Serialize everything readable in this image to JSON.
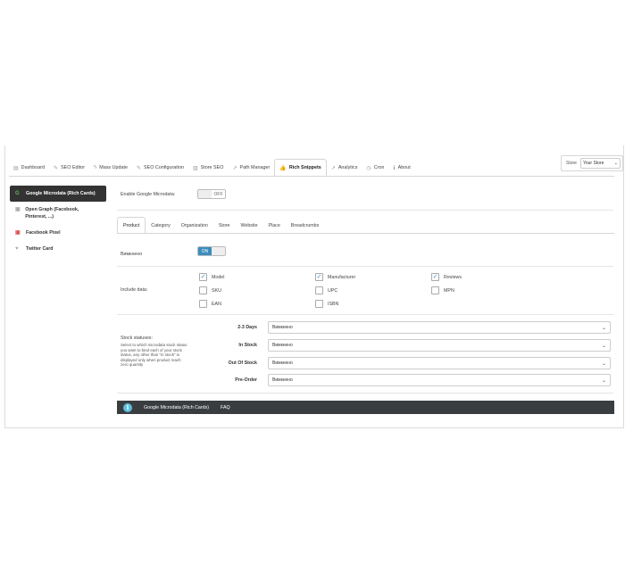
{
  "tabs": [
    {
      "label": "Dashboard",
      "icon": "dashboard-icon",
      "glyph": "▤"
    },
    {
      "label": "SEO Editor",
      "icon": "edit-icon",
      "glyph": "✎"
    },
    {
      "label": "Mass Update",
      "icon": "bolt-icon",
      "glyph": "ϟ"
    },
    {
      "label": "SEO Configuration",
      "icon": "wrench-icon",
      "glyph": "✎"
    },
    {
      "label": "Store SEO",
      "icon": "store-icon",
      "glyph": "▥"
    },
    {
      "label": "Path Manager",
      "icon": "path-icon",
      "glyph": "↗"
    },
    {
      "label": "Rich Snippets",
      "icon": "thumbs-up-icon",
      "glyph": "👍"
    },
    {
      "label": "Analytics",
      "icon": "chart-icon",
      "glyph": "↗"
    },
    {
      "label": "Cron",
      "icon": "clock-icon",
      "glyph": "◷"
    },
    {
      "label": "About",
      "icon": "info-icon",
      "glyph": "ℹ"
    }
  ],
  "store": {
    "label": "Store",
    "selected": "Your Store"
  },
  "sidebar": {
    "items": [
      {
        "label": "Google Microdata (Rich Cards)",
        "glyph": "G"
      },
      {
        "label": "Open Graph (Facebook, Pinterest, ...)",
        "glyph": "▣"
      },
      {
        "label": "Facebook Pixel",
        "glyph": "▣"
      },
      {
        "label": "Twitter Card",
        "glyph": "♥"
      }
    ]
  },
  "enable": {
    "label": "Enable Google Microdata:",
    "on_text": "",
    "off_text": "OFF"
  },
  "subtabs": [
    "Product",
    "Category",
    "Organization",
    "Store",
    "Website",
    "Place",
    "Breadcrumbs"
  ],
  "enabled_row": {
    "label": "Вимкнено",
    "on_text": "ON",
    "off_text": ""
  },
  "include": {
    "label": "Include data:",
    "items": [
      {
        "label": "Model",
        "checked": true
      },
      {
        "label": "Manufacturer",
        "checked": true
      },
      {
        "label": "Reviews",
        "checked": true
      },
      {
        "label": "SKU",
        "checked": false
      },
      {
        "label": "UPC",
        "checked": false
      },
      {
        "label": "MPN",
        "checked": false
      },
      {
        "label": "EAN",
        "checked": false
      },
      {
        "label": "ISBN",
        "checked": false
      }
    ]
  },
  "stock": {
    "title": "Stock statuses:",
    "description": "Select to which microdata stock status you want to bind each of your stock status, any other than \"in stock\" is displayed only when product reach zero quantity",
    "rows": [
      {
        "label": "2-3 Days",
        "value": "Вимкнено"
      },
      {
        "label": "In Stock",
        "value": "Вимкнено"
      },
      {
        "label": "Out Of Stock",
        "value": "Вимкнено"
      },
      {
        "label": "Pre-Order",
        "value": "Вимкнено"
      }
    ]
  },
  "footer": {
    "links": [
      "Google Microdata (Rich Cards)",
      "FAQ"
    ]
  },
  "colors": {
    "accent": "#3c8dbc",
    "active_icon": "#5cb85c",
    "footer_bg": "#3a3d40",
    "info": "#5bc0de"
  }
}
